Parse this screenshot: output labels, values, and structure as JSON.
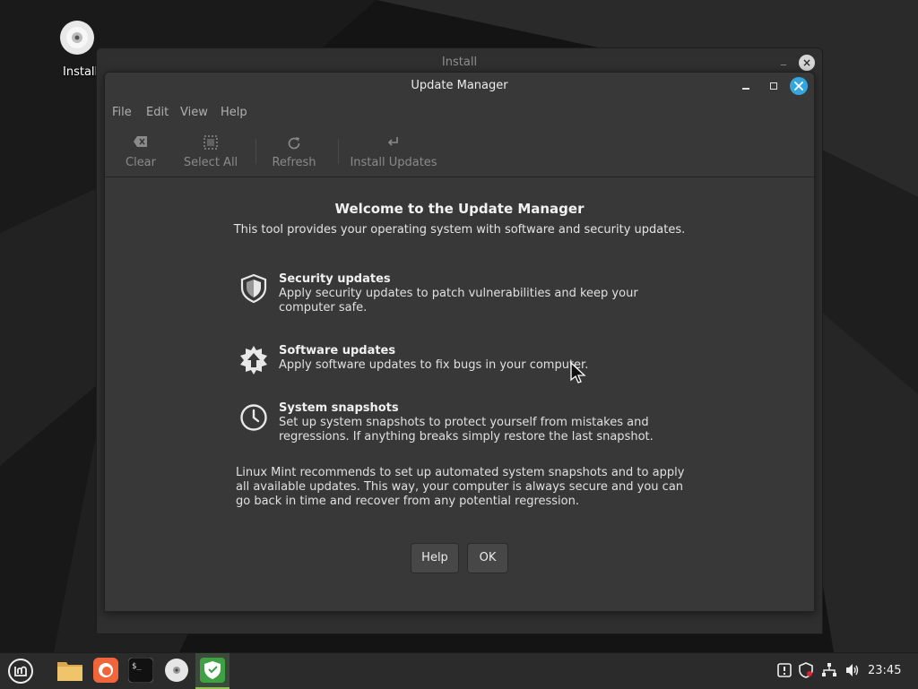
{
  "desktop": {
    "icon_label": "Install"
  },
  "install_window": {
    "title": "Install"
  },
  "window": {
    "title": "Update Manager",
    "menus": [
      "File",
      "Edit",
      "View",
      "Help"
    ],
    "toolbar": {
      "clear": "Clear",
      "select_all": "Select All",
      "refresh": "Refresh",
      "install_updates": "Install Updates"
    },
    "welcome": {
      "title": "Welcome to the Update Manager",
      "subtitle": "This tool provides your operating system with software and security updates."
    },
    "features": [
      {
        "icon": "shield-icon",
        "title": "Security updates",
        "description": "Apply security updates to patch vulnerabilities and keep your computer safe."
      },
      {
        "icon": "update-badge-icon",
        "title": "Software updates",
        "description": "Apply software updates to fix bugs in your computer."
      },
      {
        "icon": "clock-icon",
        "title": "System snapshots",
        "description": "Set up system snapshots to protect yourself from mistakes and regressions. If anything breaks simply restore the last snapshot."
      }
    ],
    "recommendation": "Linux Mint recommends to set up automated system snapshots and to apply all available updates. This way, your computer is always secure and you can go back in time and recover from any potential regression.",
    "buttons": {
      "help": "Help",
      "ok": "OK"
    }
  },
  "taskbar": {
    "apps": [
      "menu-icon",
      "files-icon",
      "firefox-icon",
      "terminal-icon",
      "install-disc-icon",
      "update-manager-icon"
    ],
    "tray": [
      "notification-icon",
      "shield-icon",
      "network-icon",
      "volume-icon"
    ],
    "clock": "23:45"
  },
  "colors": {
    "accent_close": "#35a5dd",
    "window_bg": "#383838",
    "desktop_bg": "#141414",
    "taskbar_bg": "#2b2b2b",
    "update_icon_green": "#3fa143"
  }
}
